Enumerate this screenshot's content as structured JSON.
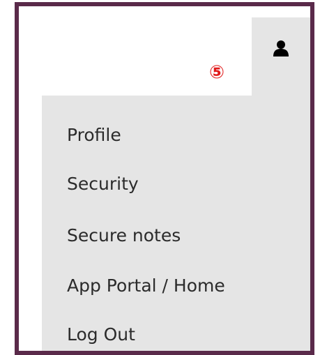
{
  "header": {
    "account_icon": "user-icon",
    "callout_marker": "⑤",
    "callout_color": "#e11b1b"
  },
  "menu": {
    "items": [
      {
        "label": "Profile"
      },
      {
        "label": "Security"
      },
      {
        "label": "Secure notes"
      },
      {
        "label": "App Portal / Home"
      },
      {
        "label": "Log Out"
      }
    ]
  },
  "colors": {
    "frame_border": "#5a2a4a",
    "menu_background": "#e5e5e5",
    "text": "#2b2b2b"
  }
}
